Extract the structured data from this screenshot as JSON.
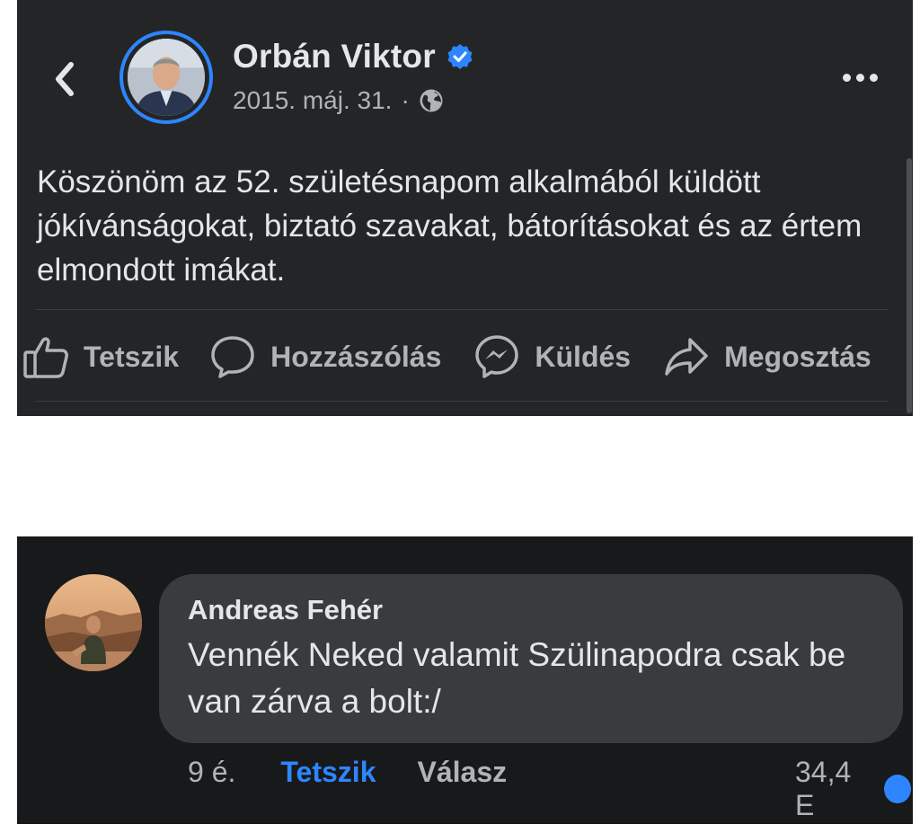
{
  "post": {
    "author": "Orbán Viktor",
    "verified_icon": "verified-badge-icon",
    "date": "2015. máj. 31.",
    "separator": "·",
    "privacy_icon": "globe-icon",
    "text": "Köszönöm az 52. születésnapom alkalmából küldött jókívánságokat, biztató szavakat, bátorításokat és az értem elmondott imákat.",
    "actions": {
      "like": "Tetszik",
      "comment": "Hozzászólás",
      "send": "Küldés",
      "share": "Megosztás"
    }
  },
  "comment": {
    "author": "Andreas Fehér",
    "text": "Vennék Neked valamit Szülinapodra csak be van zárva a bolt:/",
    "time": "9 é.",
    "like": "Tetszik",
    "reply": "Válasz",
    "reaction_count": "34,4 E"
  },
  "colors": {
    "post_background": "#242526",
    "comment_background": "#18191a",
    "bubble": "#3a3b3c",
    "accent": "#2d86ff",
    "text_primary": "#e4e6eb",
    "text_secondary": "#b0b3b8"
  }
}
